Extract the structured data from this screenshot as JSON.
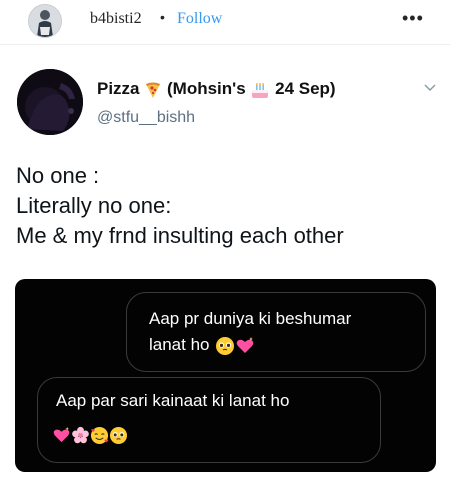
{
  "instagram": {
    "username": "b4bisti2",
    "separator": "•",
    "follow_label": "Follow",
    "more_icon": "more-horizontal-icon"
  },
  "tweet": {
    "display_name": "Pizza",
    "display_name_rest": "(Mohsin's",
    "display_name_date": "24 Sep)",
    "handle": "@stfu__bishh",
    "lines": [
      "No one :",
      "Literally no one:",
      "Me & my frnd insulting each other"
    ]
  },
  "chat": {
    "outgoing_line1": "Aap pr duniya ki beshumar",
    "outgoing_line2": "lanat ho",
    "incoming_line1": "Aap par sari kainaat ki lanat ho"
  },
  "colors": {
    "follow": "#3897f0",
    "handle": "#5b7083",
    "chat_bg": "#030303"
  }
}
